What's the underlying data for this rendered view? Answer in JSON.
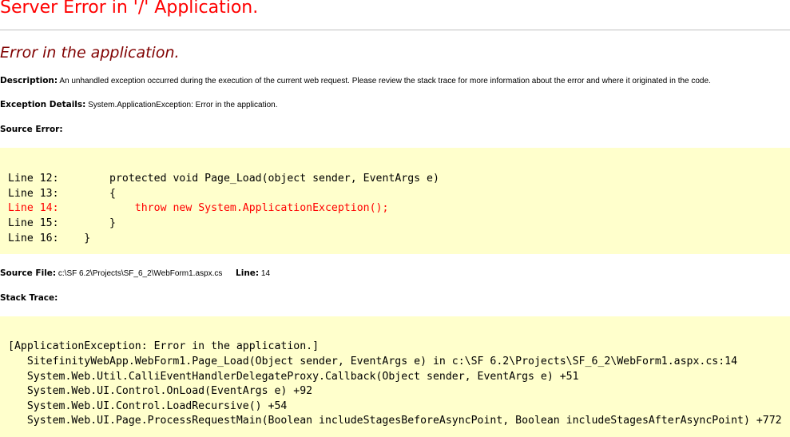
{
  "title": "Server Error in '/' Application.",
  "subtitle": "Error in the application.",
  "description": {
    "label": "Description:",
    "text": "An unhandled exception occurred during the execution of the current web request. Please review the stack trace for more information about the error and where it originated in the code."
  },
  "exception": {
    "label": "Exception Details:",
    "text": "System.ApplicationException: Error in the application."
  },
  "source_error": {
    "label": "Source Error:",
    "lines": [
      {
        "num": "Line 12:",
        "code": "        protected void Page_Load(object sender, EventArgs e)"
      },
      {
        "num": "Line 13:",
        "code": "        {"
      },
      {
        "num": "Line 14:",
        "code": "            throw new System.ApplicationException();"
      },
      {
        "num": "Line 15:",
        "code": "        }"
      },
      {
        "num": "Line 16:",
        "code": "    }"
      }
    ]
  },
  "source_file": {
    "label": "Source File:",
    "path": "c:\\SF 6.2\\Projects\\SF_6_2\\WebForm1.aspx.cs",
    "line_label": "Line:",
    "line_value": "14"
  },
  "stack_trace": {
    "label": "Stack Trace:",
    "lines": [
      "[ApplicationException: Error in the application.]",
      "   SitefinityWebApp.WebForm1.Page_Load(Object sender, EventArgs e) in c:\\SF 6.2\\Projects\\SF_6_2\\WebForm1.aspx.cs:14",
      "   System.Web.Util.CalliEventHandlerDelegateProxy.Callback(Object sender, EventArgs e) +51",
      "   System.Web.UI.Control.OnLoad(EventArgs e) +92",
      "   System.Web.UI.Control.LoadRecursive() +54",
      "   System.Web.UI.Page.ProcessRequestMain(Boolean includeStagesBeforeAsyncPoint, Boolean includeStagesAfterAsyncPoint) +772"
    ]
  },
  "colors": {
    "title": "#ff0000",
    "subtitle": "#800000",
    "code_background": "#ffffcc",
    "highlight": "#ff0000"
  }
}
